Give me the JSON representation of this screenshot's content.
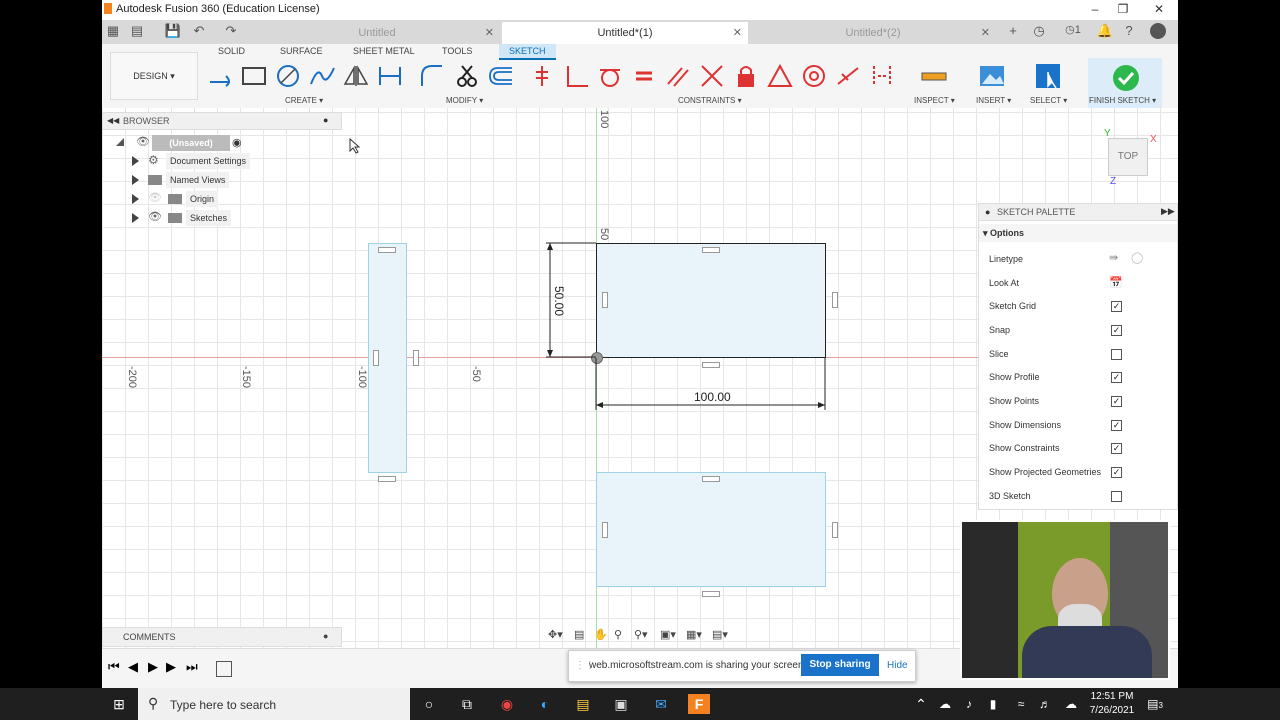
{
  "window": {
    "title": "Autodesk Fusion 360 (Education License)"
  },
  "doc_tabs": [
    {
      "label": "Untitled",
      "active": false
    },
    {
      "label": "Untitled*(1)",
      "active": true
    },
    {
      "label": "Untitled*(2)",
      "active": false
    }
  ],
  "tab_icons": {
    "job_count": "1"
  },
  "ribbon": {
    "workspace": "DESIGN",
    "tabs": [
      "SOLID",
      "SURFACE",
      "SHEET METAL",
      "TOOLS",
      "SKETCH"
    ],
    "active_tab": "SKETCH",
    "groups": {
      "create": "CREATE",
      "modify": "MODIFY",
      "constraints": "CONSTRAINTS",
      "inspect": "INSPECT",
      "insert": "INSERT",
      "select": "SELECT",
      "finish": "FINISH SKETCH"
    }
  },
  "browser": {
    "title": "BROWSER",
    "root": "(Unsaved)",
    "items": [
      "Document Settings",
      "Named Views",
      "Origin",
      "Sketches"
    ]
  },
  "canvas": {
    "axis_labels": [
      "-200",
      "-150",
      "-100",
      "-50"
    ],
    "vert_labels": [
      "100",
      "50"
    ],
    "dim_horizontal": "100.00",
    "dim_vertical": "50.00",
    "viewcube": "TOP",
    "axis_x": "X",
    "axis_y": "Y",
    "axis_z": "Z"
  },
  "palette": {
    "title": "SKETCH PALETTE",
    "section": "Options",
    "rows": [
      {
        "label": "Linetype",
        "type": "icons"
      },
      {
        "label": "Look At",
        "type": "icon"
      },
      {
        "label": "Sketch Grid",
        "checked": true
      },
      {
        "label": "Snap",
        "checked": true
      },
      {
        "label": "Slice",
        "checked": false
      },
      {
        "label": "Show Profile",
        "checked": true
      },
      {
        "label": "Show Points",
        "checked": true
      },
      {
        "label": "Show Dimensions",
        "checked": true
      },
      {
        "label": "Show Constraints",
        "checked": true
      },
      {
        "label": "Show Projected Geometries",
        "checked": true
      },
      {
        "label": "3D Sketch",
        "checked": false
      }
    ]
  },
  "comments": {
    "label": "COMMENTS"
  },
  "share_bar": {
    "message": "web.microsoftstream.com is sharing your screen.",
    "stop": "Stop sharing",
    "hide": "Hide"
  },
  "taskbar": {
    "search_placeholder": "Type here to search",
    "time": "12:51 PM",
    "date": "7/26/2021",
    "notif_count": "3"
  },
  "colors": {
    "accent": "#0a6fb5",
    "sketch_fill": "#e8f4f9",
    "sketch_edge": "#9ed2e6",
    "finish_green": "#2db84d",
    "taskbar": "#1f1f1f"
  }
}
